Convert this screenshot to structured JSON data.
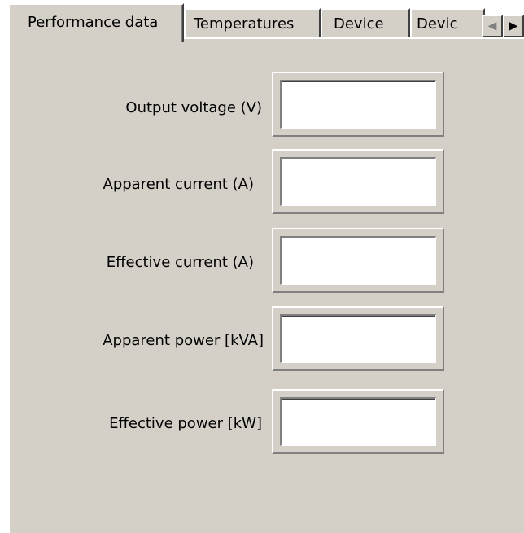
{
  "tabs": [
    {
      "label": "Performance data",
      "active": true
    },
    {
      "label": "Temperatures",
      "active": false
    },
    {
      "label": "Device",
      "active": false
    },
    {
      "label": "Devic",
      "active": false
    }
  ],
  "tab_scroll": {
    "left_icon": "arrow-left-icon",
    "right_icon": "arrow-right-icon",
    "left_glyph": "◀",
    "right_glyph": "▶"
  },
  "fields": [
    {
      "label": "Output voltage (V)",
      "value": ""
    },
    {
      "label": "Apparent current (A)",
      "value": ""
    },
    {
      "label": "Effective current (A)",
      "value": ""
    },
    {
      "label": "Apparent power [kVA]",
      "value": ""
    },
    {
      "label": "Effective power [kW]",
      "value": ""
    }
  ],
  "colors": {
    "face": "#d4d0c8",
    "highlight": "#ffffff",
    "shadow": "#808080",
    "dark_shadow": "#404040"
  }
}
